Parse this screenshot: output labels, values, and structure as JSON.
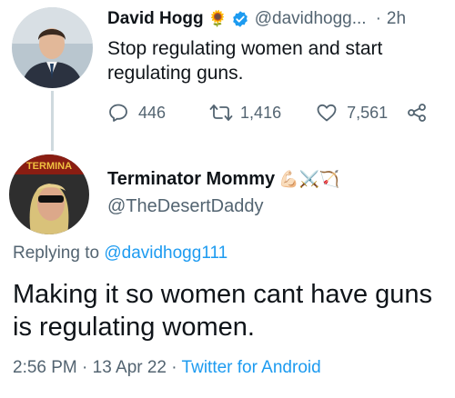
{
  "tweet1": {
    "author_name": "David Hogg",
    "name_emoji": "🌻",
    "handle": "@davidhogg...",
    "separator": "·",
    "time": "2h",
    "text": "Stop regulating women and start regulating guns.",
    "replies": "446",
    "retweets": "1,416",
    "likes": "7,561"
  },
  "tweet2": {
    "author_name": "Terminator Mommy",
    "name_emojis": "💪🏻⚔️🏹",
    "handle": "@TheDesertDaddy",
    "avatar_text": "TERMINA",
    "replying_prefix": "Replying to",
    "replying_handle": "@davidhogg111",
    "text": "Making it so women cant have guns is regulating women.",
    "time": "2:56 PM",
    "date": "13 Apr 22",
    "client": "Twitter for Android",
    "meta_sep": "·"
  },
  "colors": {
    "link": "#1d9bf0",
    "muted": "#536471",
    "verified": "#1d9bf0",
    "text": "#0f1419"
  }
}
